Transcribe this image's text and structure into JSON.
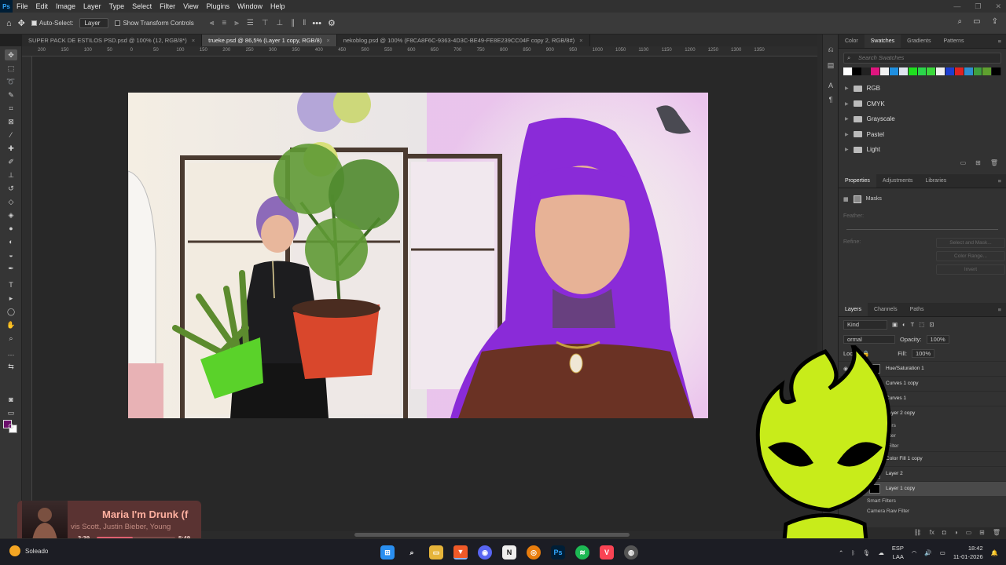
{
  "app": {
    "logo": "Ps"
  },
  "menu": [
    "File",
    "Edit",
    "Image",
    "Layer",
    "Type",
    "Select",
    "Filter",
    "View",
    "Plugins",
    "Window",
    "Help"
  ],
  "options_bar": {
    "auto_select_label": "Auto-Select:",
    "auto_select_checked": true,
    "target_value": "Layer",
    "transform_label": "Show Transform Controls",
    "transform_checked": false,
    "more": "•••"
  },
  "tabs": [
    {
      "label": "SUPER PACK DE ESTILOS PSD.psd @ 100% (12, RGB/8*)",
      "active": false
    },
    {
      "label": "trueke.psd @ 86,5% (Layer 1 copy, RGB/8)",
      "active": true
    },
    {
      "label": "nekoblog.psd @ 100% (F8CA8F6C-9363-4D3C-BE49-FE8E239CC04F copy 2, RGB/8#)",
      "active": false
    }
  ],
  "ruler": [
    "200",
    "150",
    "100",
    "50",
    "0",
    "50",
    "100",
    "150",
    "200",
    "250",
    "300",
    "350",
    "400",
    "450",
    "500",
    "550",
    "600",
    "650",
    "700",
    "750",
    "800",
    "850",
    "900",
    "950",
    "1000",
    "1050",
    "1100",
    "1150",
    "1200",
    "1250",
    "1300",
    "1350"
  ],
  "swatches_panel": {
    "tabs": [
      "Color",
      "Swatches",
      "Gradients",
      "Patterns"
    ],
    "active_tab": "Swatches",
    "search_placeholder": "Search Swatches",
    "colors": [
      "#ffffff",
      "#000000",
      "#222222",
      "#e0157f",
      "#f2f2f2",
      "#1f8fe0",
      "#dfe4ef",
      "#1fe01f",
      "#2bd64b",
      "#3cd83c",
      "#f0f0f0",
      "#1e3fd0",
      "#e02222",
      "#2f8fd0",
      "#3fa03f",
      "#5fa02f",
      "#000000"
    ],
    "folders": [
      "RGB",
      "CMYK",
      "Grayscale",
      "Pastel",
      "Light"
    ]
  },
  "properties_panel": {
    "tabs": [
      "Properties",
      "Adjustments",
      "Libraries"
    ],
    "active_tab": "Properties",
    "masks_label": "Masks",
    "feather_label": "Feather:",
    "refine_label": "Refine:",
    "buttons": [
      "Select and Mask...",
      "Color Range...",
      "Invert"
    ]
  },
  "layers_panel": {
    "tabs": [
      "Layers",
      "Channels",
      "Paths"
    ],
    "active_tab": "Layers",
    "kind": "Kind",
    "blend_mode": "ormal",
    "opacity_label": "Opacity:",
    "opacity_value": "100%",
    "lock_label": "Lock:",
    "fill_label": "Fill:",
    "fill_value": "100%",
    "layers": [
      {
        "name": "Hue/Saturation 1",
        "type": "layer",
        "thumb": "w"
      },
      {
        "name": "Curves 1 copy",
        "type": "layer",
        "thumb": "b"
      },
      {
        "name": "Curves 1",
        "type": "layer",
        "thumb": "b"
      },
      {
        "name": "Layer 2 copy",
        "type": "layer",
        "thumb": "b"
      },
      {
        "name": "Smart Filters",
        "type": "sub"
      },
      {
        "name": "ra Raw Filter",
        "type": "sub"
      },
      {
        "name": "era Raw Filter",
        "type": "sub"
      },
      {
        "name": "Color Fill 1 copy",
        "type": "layer",
        "thumb": "b"
      },
      {
        "name": "Layer 2",
        "type": "layer",
        "thumb": "w"
      },
      {
        "name": "Layer 1 copy",
        "type": "layer",
        "thumb": "b",
        "active": true
      },
      {
        "name": "Smart Filters",
        "type": "sub"
      },
      {
        "name": "Camera Raw Filter",
        "type": "sub"
      }
    ]
  },
  "media_player": {
    "title": "Maria I'm Drunk (f",
    "artist": "vis Scott, Justin Bieber, Young",
    "elapsed": "2:39",
    "total": "5:49",
    "progress": 0.46
  },
  "taskbar": {
    "weather_temp": "",
    "weather_label": "Soleado",
    "apps": [
      "windows",
      "search",
      "files",
      "brave",
      "discord",
      "notion",
      "blender",
      "photoshop",
      "spotify",
      "valorant",
      "chrome"
    ],
    "lang": "ESP",
    "lang_sub": "LAA",
    "time": "18:42",
    "date": "11-01-2026"
  }
}
